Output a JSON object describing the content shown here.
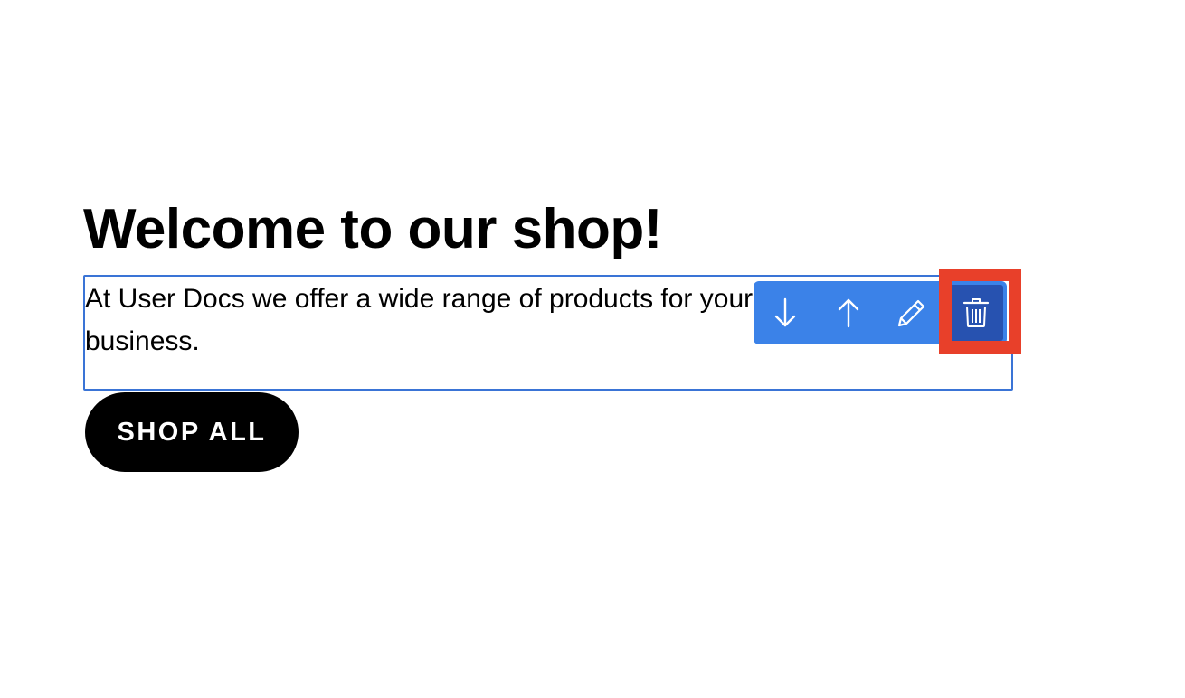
{
  "hero": {
    "heading": "Welcome to our shop!",
    "description": "At User Docs we offer a wide range of products for your business.",
    "cta_label": "SHOP ALL"
  },
  "block_toolbar": {
    "actions": [
      {
        "name": "move-down",
        "icon": "arrow-down-icon"
      },
      {
        "name": "move-up",
        "icon": "arrow-up-icon"
      },
      {
        "name": "edit",
        "icon": "pencil-icon"
      },
      {
        "name": "delete",
        "icon": "trash-icon"
      }
    ],
    "colors": {
      "toolbar_bg": "#3b82e8",
      "delete_bg": "#2752b0",
      "selection_border": "#3a74d6",
      "highlight": "#e8402a"
    }
  }
}
